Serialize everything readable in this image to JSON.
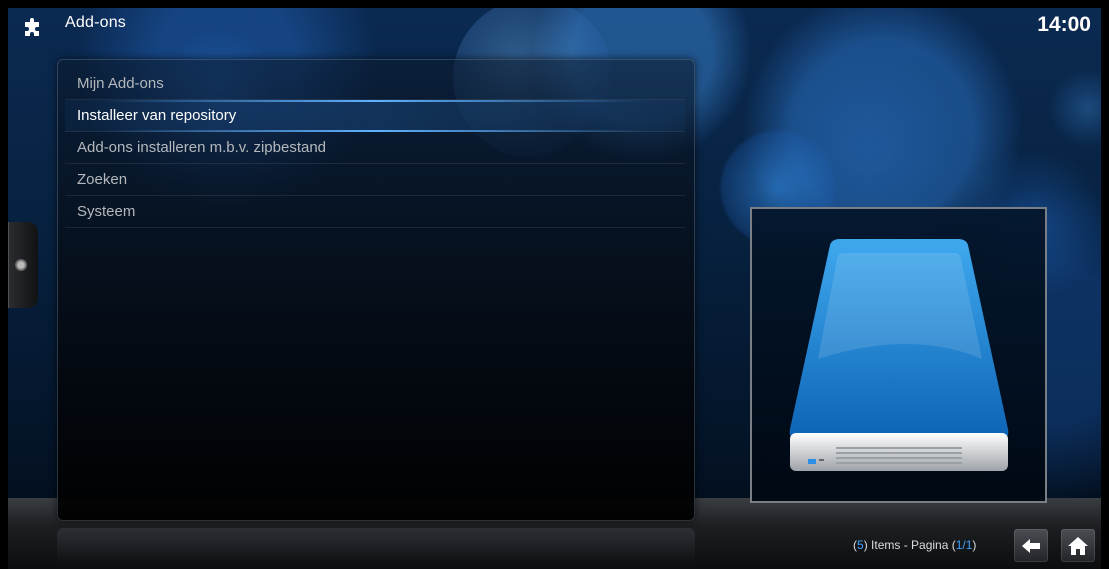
{
  "header": {
    "title": "Add-ons",
    "icon": "puzzle-icon",
    "clock": "14:00"
  },
  "menu": {
    "items": [
      {
        "label": "Mijn Add-ons",
        "focused": false
      },
      {
        "label": "Installeer van repository",
        "focused": true
      },
      {
        "label": "Add-ons installeren m.b.v. zipbestand",
        "focused": false
      },
      {
        "label": "Zoeken",
        "focused": false
      },
      {
        "label": "Systeem",
        "focused": false
      }
    ]
  },
  "preview": {
    "icon": "hard-drive-icon"
  },
  "footer": {
    "count_open": "(",
    "count": "5",
    "count_close": ")",
    "items_page": " Items - Pagina ",
    "page_open": "(",
    "page": "1/1",
    "page_close": ")",
    "back_icon": "back-arrow-icon",
    "home_icon": "home-icon"
  },
  "colors": {
    "accent": "#3fa2ff",
    "focus_bar": "#5fb2ff",
    "text_default": "#b4b8bd",
    "text_focused": "#ffffff"
  }
}
